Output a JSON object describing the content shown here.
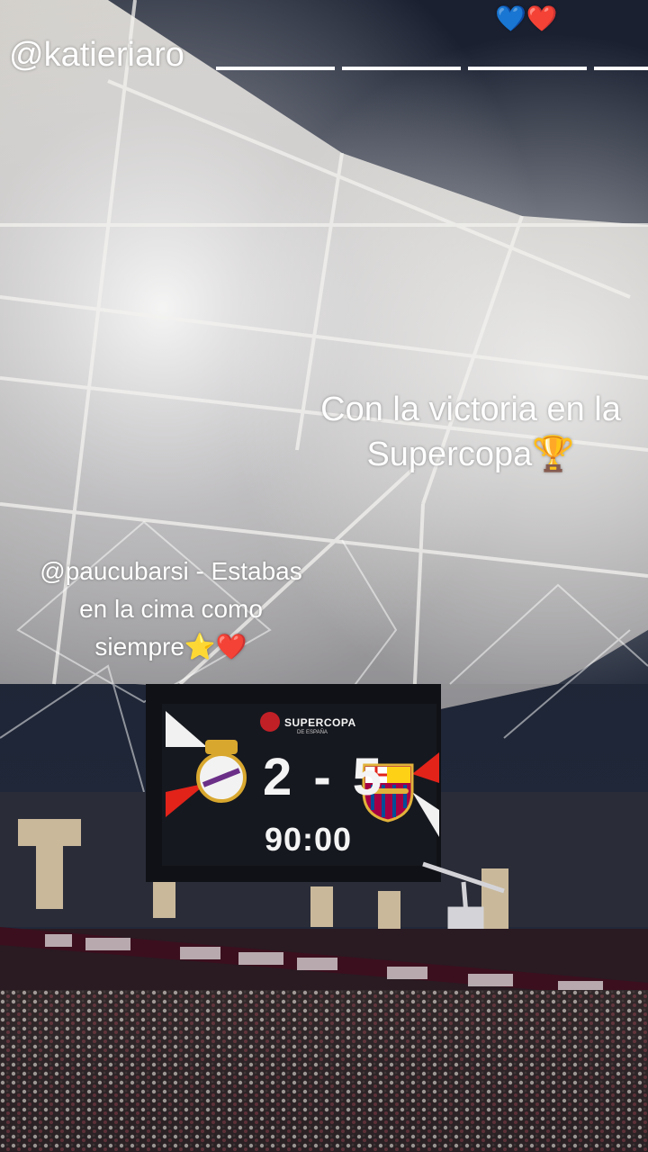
{
  "story": {
    "top_mention": "@katieriaro",
    "hearts": "💙❤️",
    "victory_caption": "Con la victoria en la\nSupercopa🏆",
    "tag_caption": "@paucubarsi - Estabas\nen la cima como\nsiempre⭐️❤️"
  },
  "scoreboard": {
    "competition": "SUPERCOPA",
    "competition_sub": "DE ESPAÑA",
    "score": "2 - 5",
    "time": "90:00",
    "home_crest": "real-madrid-crest-icon",
    "away_crest": "fc-barcelona-crest-icon"
  },
  "colors": {
    "sky": "#1b2233",
    "roof": "#d8d6d2",
    "scoreboard_bg": "#16181f",
    "accent_red": "#e2231a"
  }
}
